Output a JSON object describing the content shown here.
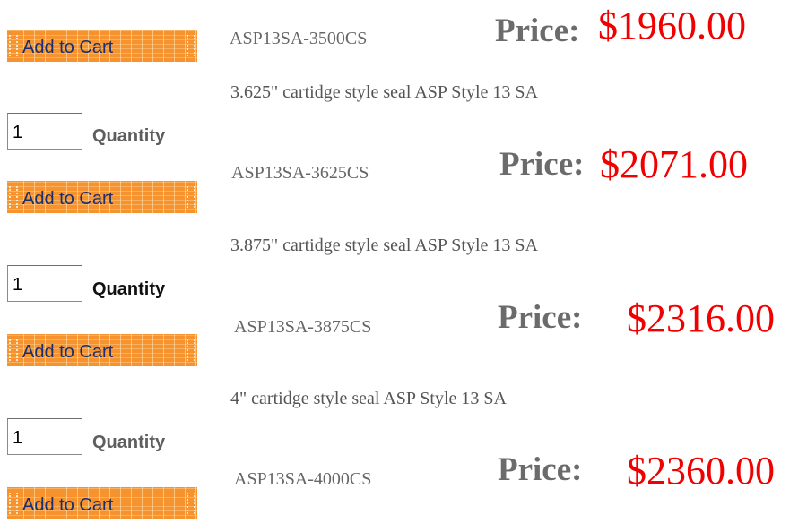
{
  "colors": {
    "button_bg": "#f7932e",
    "button_text": "#1a2f6e",
    "price_value": "#f00000",
    "price_label": "#6b6b6b",
    "sku_text": "#666666",
    "quantity_label_gray": "#5e5e5e",
    "quantity_label_dark": "#111111"
  },
  "products": [
    {
      "cart_label": "Add to Cart",
      "sku": "ASP13SA-3500CS",
      "price_label": "Price:",
      "price": "$1960.00"
    },
    {
      "description": "3.625\"  cartidge style seal ASP Style 13 SA",
      "quantity_value": "1",
      "quantity_label": "Quantity",
      "cart_label": "Add to Cart",
      "sku": "ASP13SA-3625CS",
      "price_label": "Price:",
      "price": "$2071.00"
    },
    {
      "description": "3.875\"  cartidge style seal ASP Style 13 SA",
      "quantity_value": "1",
      "quantity_label": "Quantity",
      "cart_label": "Add to Cart",
      "sku": "ASP13SA-3875CS",
      "price_label": "Price:",
      "price": "$2316.00"
    },
    {
      "description": "4\"  cartidge style seal ASP Style 13 SA",
      "quantity_value": "1",
      "quantity_label": "Quantity",
      "cart_label": "Add to Cart",
      "sku": "ASP13SA-4000CS",
      "price_label": "Price:",
      "price": "$2360.00"
    }
  ]
}
